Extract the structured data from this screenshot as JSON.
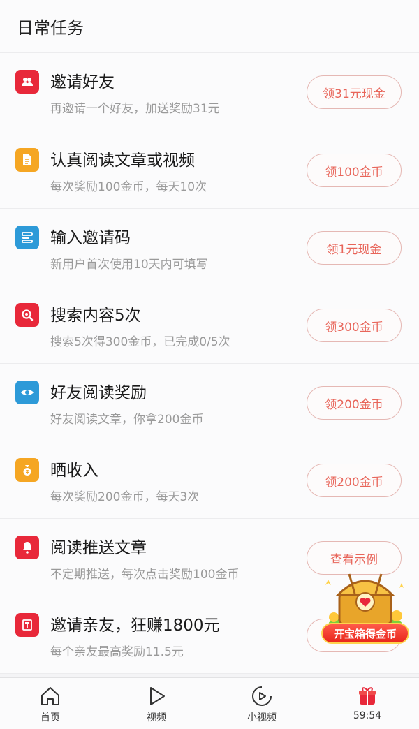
{
  "header": {
    "title": "日常任务"
  },
  "tasks": [
    {
      "title": "邀请好友",
      "desc": "再邀请一个好友，加送奖励31元",
      "button": "领31元现金",
      "icon": "friends-icon",
      "color": "#e8283a"
    },
    {
      "title": "认真阅读文章或视频",
      "desc": "每次奖励100金币，每天10次",
      "button": "领100金币",
      "icon": "document-icon",
      "color": "#f5a623"
    },
    {
      "title": "输入邀请码",
      "desc": "新用户首次使用10天内可填写",
      "button": "领1元现金",
      "icon": "code-icon",
      "color": "#2d9ad8"
    },
    {
      "title": "搜索内容5次",
      "desc": "搜索5次得300金币，已完成0/5次",
      "button": "领300金币",
      "icon": "search-icon",
      "color": "#e8283a"
    },
    {
      "title": "好友阅读奖励",
      "desc": "好友阅读文章，你拿200金币",
      "button": "领200金币",
      "icon": "eye-icon",
      "color": "#2d9ad8"
    },
    {
      "title": "晒收入",
      "desc": "每次奖励200金币，每天3次",
      "button": "领200金币",
      "icon": "money-bag-icon",
      "color": "#f5a623"
    },
    {
      "title": "阅读推送文章",
      "desc": "不定期推送，每次点击奖励100金币",
      "button": "查看示例",
      "icon": "bell-icon",
      "color": "#e8283a"
    },
    {
      "title": "邀请亲友，狂赚1800元",
      "desc": "每个亲友最高奖励11.5元",
      "button": "",
      "icon": "gift-icon",
      "color": "#e8283a"
    }
  ],
  "treasure": {
    "label": "开宝箱得金币"
  },
  "tabbar": {
    "home": "首页",
    "video": "视频",
    "short_video": "小视频",
    "timer": "59:54"
  }
}
